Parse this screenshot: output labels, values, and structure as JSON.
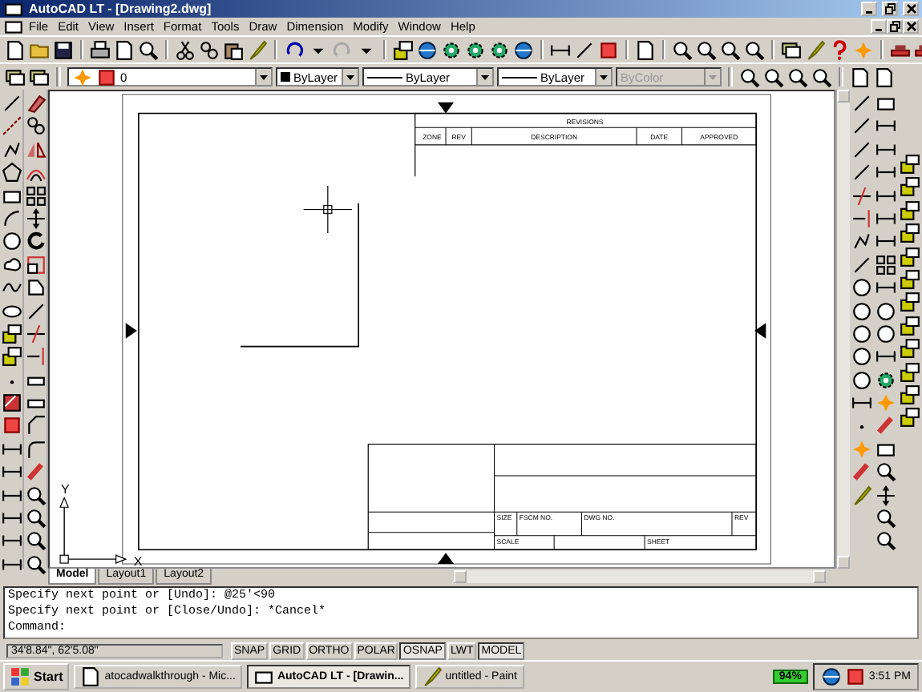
{
  "window": {
    "title": "AutoCAD LT - [Drawing2.dwg]"
  },
  "menu": [
    "File",
    "Edit",
    "View",
    "Insert",
    "Format",
    "Tools",
    "Draw",
    "Dimension",
    "Modify",
    "Window",
    "Help"
  ],
  "properties_toolbar": {
    "layer": "0",
    "color_setting": "ByLayer",
    "linetype": "ByLayer",
    "lineweight": "ByLayer",
    "plot_style": {
      "value": "ByColor",
      "disabled": true
    }
  },
  "drawing": {
    "revisions": {
      "title": "REVISIONS",
      "columns": [
        "ZONE",
        "REV",
        "DESCRIPTION",
        "DATE",
        "APPROVED"
      ]
    },
    "title_block": {
      "row_1": [
        "SIZE",
        "FSCM NO.",
        "DWG NO.",
        "REV"
      ],
      "row_2": [
        "SCALE",
        "SHEET"
      ]
    },
    "ucs": {
      "y": "Y",
      "x": "X"
    }
  },
  "layout_tabs": [
    {
      "label": "Model",
      "selected": true
    },
    {
      "label": "Layout1",
      "selected": false
    },
    {
      "label": "Layout2",
      "selected": false
    }
  ],
  "command_lines": [
    "Specify next point or [Undo]: @25'<90",
    "Specify next point or [Close/Undo]: *Cancel*",
    "Command:"
  ],
  "status_bar": {
    "coordinates": "34'8.84\", 62'5.08\"",
    "toggles": [
      {
        "label": "SNAP",
        "on": false
      },
      {
        "label": "GRID",
        "on": false
      },
      {
        "label": "ORTHO",
        "on": false
      },
      {
        "label": "POLAR",
        "on": false
      },
      {
        "label": "OSNAP",
        "on": true
      },
      {
        "label": "LWT",
        "on": false
      },
      {
        "label": "MODEL",
        "on": true
      }
    ]
  },
  "taskbar": {
    "start": "Start",
    "tasks": [
      {
        "label": "atocadwalkthrough - Mic...",
        "selected": false
      },
      {
        "label": "AutoCAD LT - [Drawin...",
        "selected": true
      },
      {
        "label": "untitled - Paint",
        "selected": false
      }
    ],
    "battery": "94%",
    "clock": "3:51 PM"
  }
}
